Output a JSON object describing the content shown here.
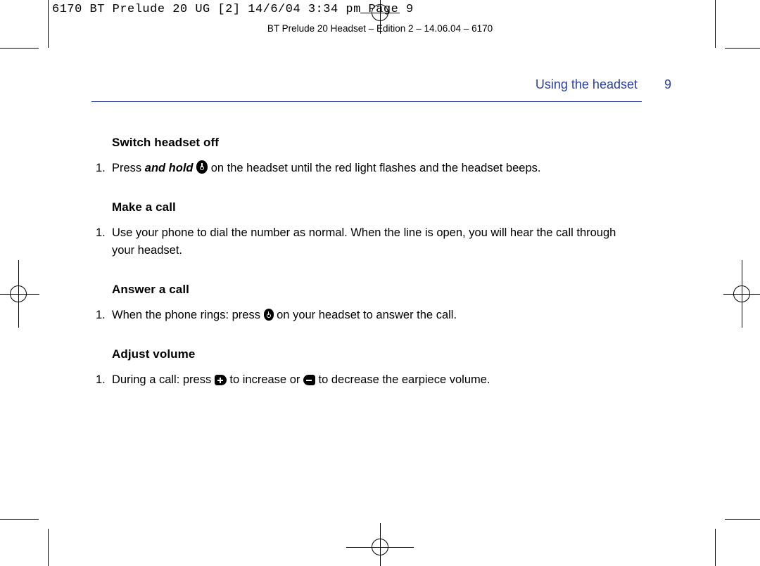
{
  "imposition": {
    "job_line": "6170 BT Prelude 20 UG [2]  14/6/04  3:34 pm  Page 9",
    "running_head": "BT Prelude 20 Headset – Edition 2 – 14.06.04 – 6170"
  },
  "header": {
    "chapter_title": "Using the headset",
    "page_number": "9",
    "accent_color": "#2a3f9d"
  },
  "sections": [
    {
      "heading": "Switch headset off",
      "number": "1.",
      "text_before_italic": "Press ",
      "italic_text": "and hold",
      "text_after_italic": " ",
      "icon": "power-button-icon",
      "text_after_icon": " on the headset until the red light flashes and the headset beeps."
    },
    {
      "heading": "Make a call",
      "number": "1.",
      "text": "Use your phone to dial the number as normal. When the line is open, you will hear the call through your headset."
    },
    {
      "heading": "Answer a call",
      "number": "1.",
      "text_before_icon": "When the phone rings: press ",
      "icon": "power-button-icon",
      "text_after_icon": " on your headset to answer the call."
    },
    {
      "heading": "Adjust volume",
      "number": "1.",
      "text_before_icon1": "During a call: press ",
      "icon1": "volume-up-icon",
      "text_between_icons": " to increase or ",
      "icon2": "volume-down-icon",
      "text_after_icon2": " to decrease the earpiece volume."
    }
  ]
}
